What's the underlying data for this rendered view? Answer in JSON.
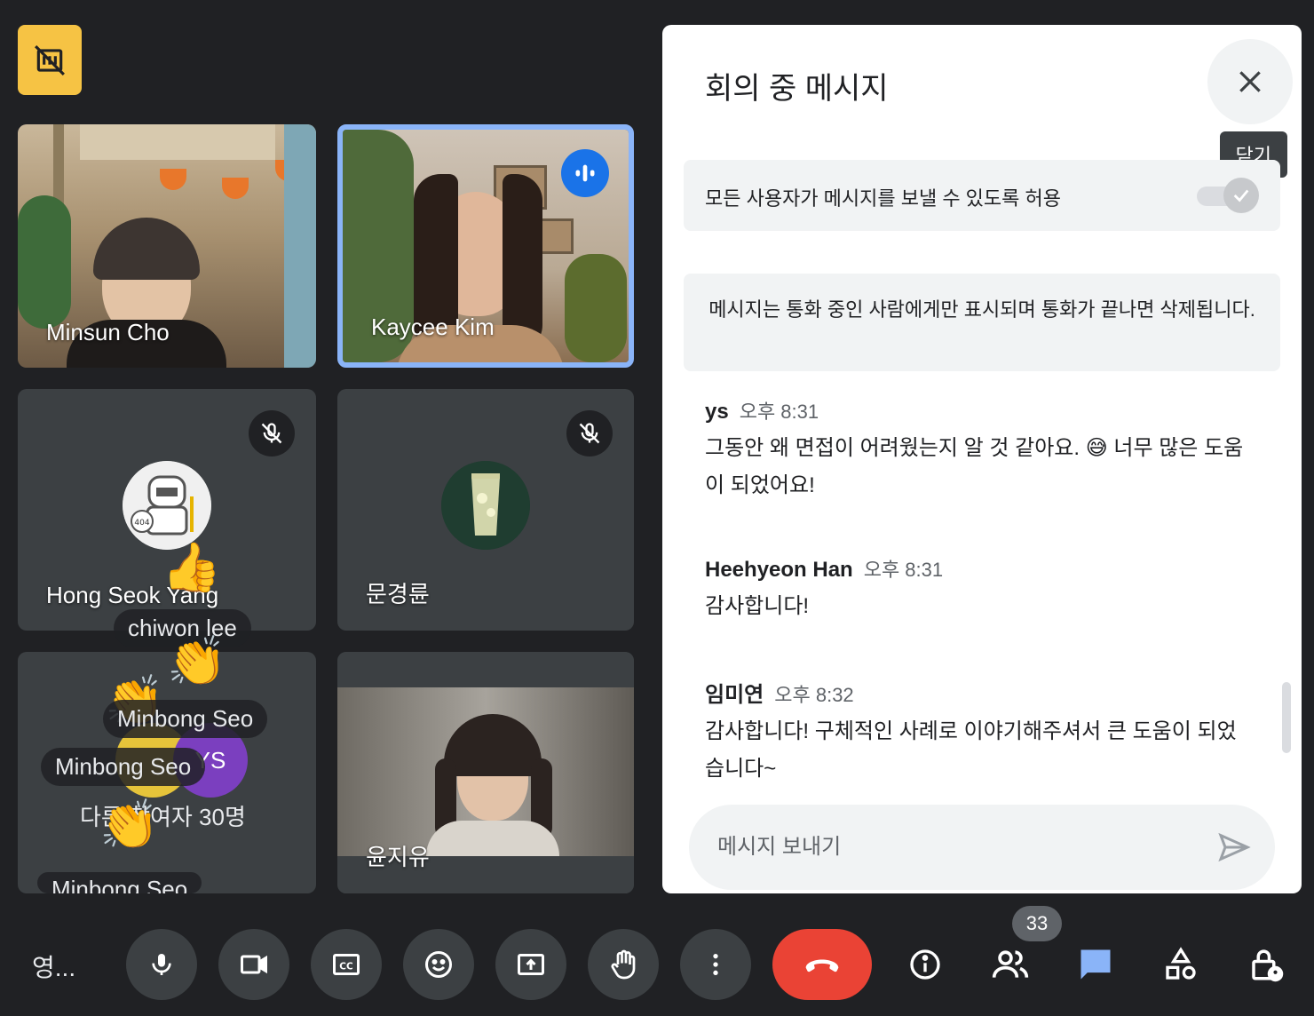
{
  "top_badge": {
    "icon": "no-present-icon",
    "color": "#f6c344"
  },
  "tiles": [
    {
      "name": "Minsun Cho"
    },
    {
      "name": "Kaycee Kim"
    },
    {
      "name": "Hong Seok Yang"
    },
    {
      "name": "문경륜"
    },
    {
      "name": ""
    },
    {
      "name": "윤지유"
    }
  ],
  "others": {
    "label": "다른 참여자 30명",
    "ys_initials": "YS"
  },
  "reactions": [
    {
      "name": "chiwon lee"
    },
    {
      "name": "Minbong Seo"
    },
    {
      "name": "Minbong Seo"
    },
    {
      "name": "Minbong Seo"
    }
  ],
  "panel": {
    "title": "회의 중 메시지",
    "close_tooltip": "닫기",
    "allow_label": "모든 사용자가 메시지를 보낼 수 있도록 허용",
    "allow_enabled": true,
    "info": "메시지는 통화 중인 사람에게만 표시되며 통화가 끝나면 삭제됩니다.",
    "messages": [
      {
        "sender": "ys",
        "time": "오후 8:31",
        "body": "그동안 왜 면접이 어려웠는지 알 것 같아요. 😅 너무 많은 도움이 되었어요!"
      },
      {
        "sender": "Heehyeon Han",
        "time": "오후 8:31",
        "body": "감사합니다!"
      },
      {
        "sender": "임미연",
        "time": "오후 8:32",
        "body": "감사합니다! 구체적인 사례로 이야기해주셔서 큰 도움이 되었습니다~"
      }
    ],
    "input_placeholder": "메시지 보내기"
  },
  "bottom": {
    "meeting_name": "영...",
    "participant_count": "33",
    "accent": "#8ab4f8",
    "end_call_color": "#ea4335"
  }
}
